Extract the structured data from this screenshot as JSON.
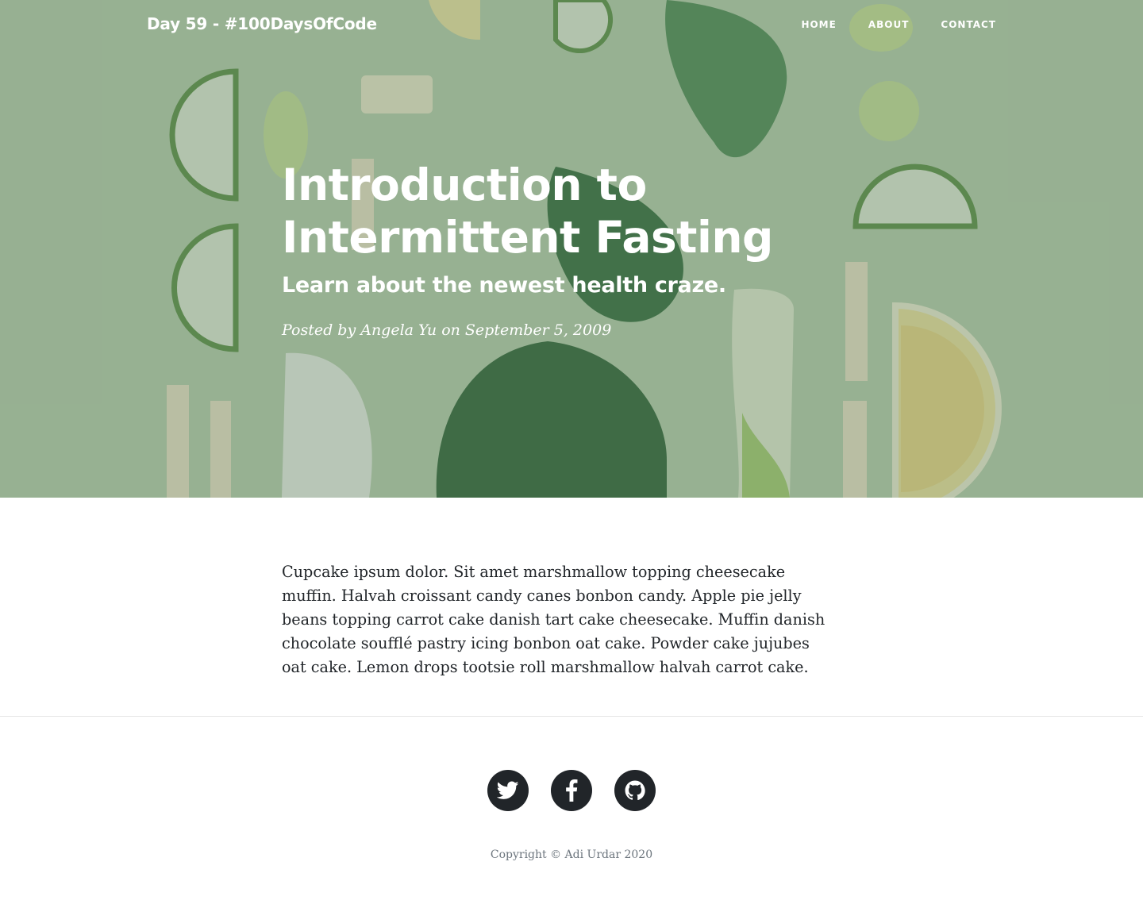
{
  "navbar": {
    "brand": "Day 59 - #100DaysOfCode",
    "links": [
      {
        "label": "HOME"
      },
      {
        "label": "ABOUT"
      },
      {
        "label": "CONTACT"
      }
    ]
  },
  "hero": {
    "title_line_1": "Introduction to",
    "title_line_2": "Intermittent Fasting",
    "subtitle": "Learn about the newest health craze.",
    "meta": "Posted by Angela Yu on September 5, 2009"
  },
  "article": {
    "body": "Cupcake ipsum dolor. Sit amet marshmallow topping cheesecake muffin. Halvah croissant candy canes bonbon candy. Apple pie jelly beans topping carrot cake danish tart cake cheesecake. Muffin danish chocolate soufflé pastry icing bonbon oat cake. Powder cake jujubes oat cake. Lemon drops tootsie roll marshmallow halvah carrot cake."
  },
  "footer": {
    "social": [
      {
        "icon": "twitter-icon"
      },
      {
        "icon": "facebook-icon"
      },
      {
        "icon": "github-icon"
      }
    ],
    "copyright": "Copyright © Adi Urdar 2020"
  },
  "colors": {
    "hero_tint": "#a9c2a2",
    "text_dark": "#212529",
    "muted": "#6c757d",
    "divider": "#e5e5e5"
  }
}
